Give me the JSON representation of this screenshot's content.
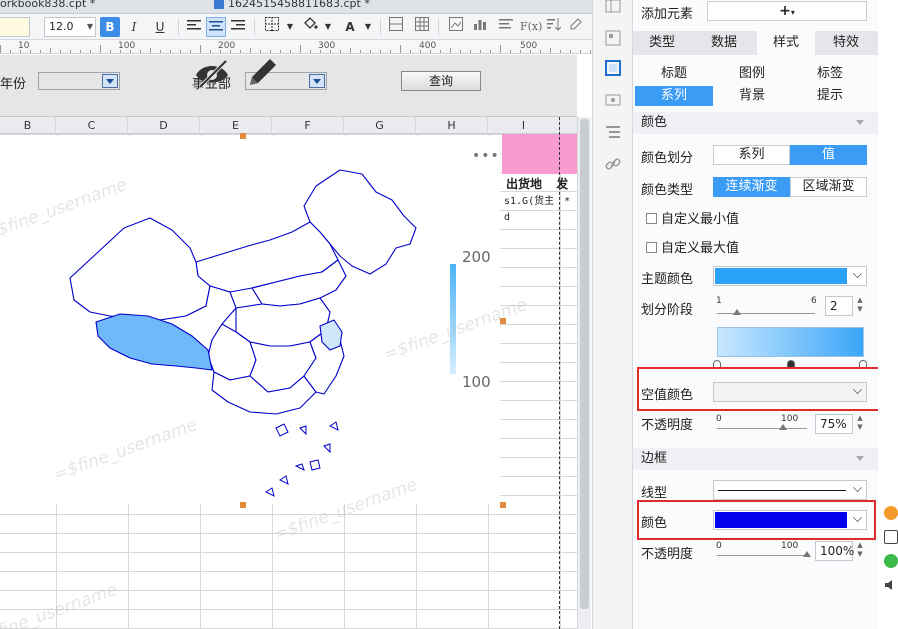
{
  "tabs": [
    {
      "label": "orkbook838.cpt *"
    },
    {
      "label": "1624515458811683.cpt *"
    }
  ],
  "toolbar": {
    "font_name": "",
    "font_size": "12.0",
    "bold": "B",
    "italic": "I",
    "underline": "U",
    "fx": "F(x)"
  },
  "ruler": {
    "marks": [
      "10",
      "100",
      "200",
      "300",
      "400",
      "500"
    ]
  },
  "params": {
    "year_label": "年份",
    "dept_label": "事业部",
    "query_button": "查询"
  },
  "columns": [
    "B",
    "C",
    "D",
    "E",
    "F",
    "G",
    "H",
    "I"
  ],
  "sheet": {
    "header_cell": "出货地",
    "header_cell2": "发",
    "sub_cell": "s1.G(货主",
    "sub_cell2": "* d"
  },
  "chart": {
    "more": "•••",
    "legend_max": "200",
    "legend_min": "100",
    "watermark": "=$fine_username"
  },
  "props": {
    "add_element_label": "添加元素",
    "add_symbol": "+",
    "tabs": [
      "类型",
      "数据",
      "样式",
      "特效"
    ],
    "active_tab": "样式",
    "subtabs": [
      "标题",
      "图例",
      "标签",
      "系列",
      "背景",
      "提示"
    ],
    "active_subtab": "系列",
    "color_section": "颜色",
    "color_division_label": "颜色划分",
    "color_division_options": [
      "系列",
      "值"
    ],
    "color_type_label": "颜色类型",
    "color_type_options": [
      "连续渐变",
      "区域渐变"
    ],
    "custom_min": "自定义最小值",
    "custom_max": "自定义最大值",
    "theme_color_label": "主题颜色",
    "theme_color": "#2aa3f7",
    "stage_label": "划分阶段",
    "stage_min": "1",
    "stage_max": "6",
    "stage_value": "2",
    "empty_color_label": "空值颜色",
    "opacity_label": "不透明度",
    "opacity_min": "0",
    "opacity_max": "100",
    "opacity_value": "75%",
    "border_section": "边框",
    "line_type_label": "线型",
    "border_color_label": "颜色",
    "border_color": "#0000ee",
    "border_opacity_label": "不透明度",
    "border_opacity_min": "0",
    "border_opacity_max": "100",
    "border_opacity_value": "100%"
  },
  "colors": {
    "accent": "#3b9cf5",
    "map_border": "#0000cc",
    "map_fill_high": "#6fb8f9",
    "map_fill_low": "#cfe6fb",
    "pink_header": "#f79bd0",
    "highlight_red": "#e12b2b"
  }
}
